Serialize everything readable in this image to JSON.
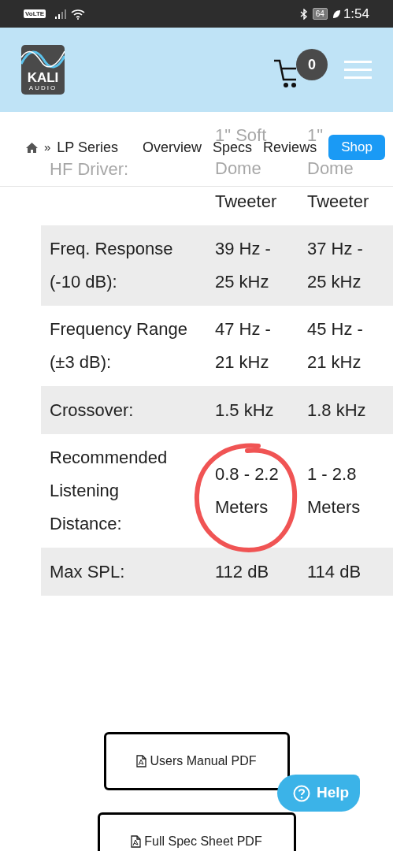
{
  "status_bar": {
    "network_badge": "VoLTE",
    "battery": "64",
    "time": "1:54"
  },
  "header": {
    "logo_text": "KALI",
    "logo_subtext": "AUDIO",
    "cart_count": "0"
  },
  "nav": {
    "separator": "»",
    "current": "LP Series",
    "links": [
      "Overview",
      "Specs",
      "Reviews"
    ],
    "shop_button": "Shop"
  },
  "specs": [
    {
      "label": "HF Driver:",
      "values": [
        [
          "1\" Soft",
          "Dome",
          "Tweeter"
        ],
        [
          "1\"",
          "Dome",
          "Tweeter"
        ]
      ]
    },
    {
      "label": "Freq. Response (-10 dB):",
      "values": [
        "39 Hz - 25 kHz",
        "37 Hz - 25 kHz"
      ]
    },
    {
      "label": "Frequency Range (±3 dB):",
      "values": [
        "47 Hz - 21 kHz",
        "45 Hz - 21 kHz"
      ]
    },
    {
      "label": "Crossover:",
      "values": [
        "1.5 kHz",
        "1.8 kHz"
      ]
    },
    {
      "label": "Recommended Listening Distance:",
      "values": [
        "0.8 - 2.2 Meters",
        "1 - 2.8 Meters"
      ]
    },
    {
      "label": "Max SPL:",
      "values": [
        "112 dB",
        "114 dB"
      ]
    }
  ],
  "downloads": [
    "Users Manual PDF",
    "Full Spec Sheet PDF"
  ],
  "help_button": "Help"
}
